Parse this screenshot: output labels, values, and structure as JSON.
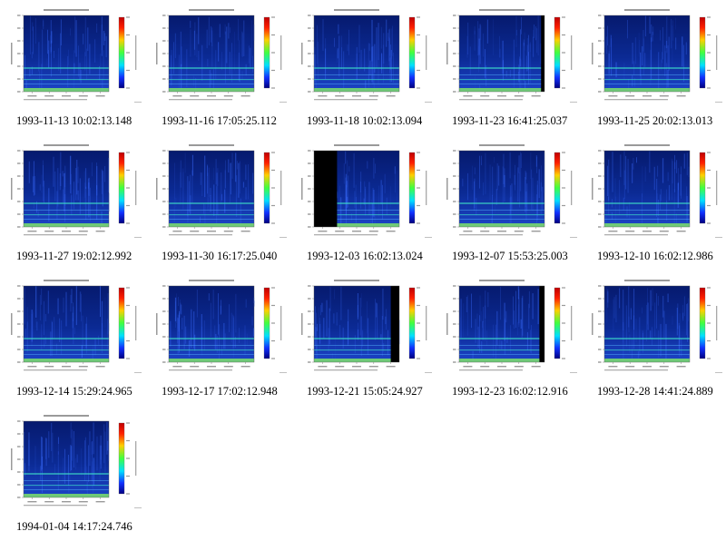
{
  "colors": {
    "background": "#ffffff",
    "caption_text": "#000000",
    "spectrogram_dark": "#061a6e",
    "spectrogram_mid": "#1c44c8",
    "band_line": "#3fe0c8",
    "baseline": "#7ee06a",
    "mask": "#000000"
  },
  "gallery": {
    "columns": 5,
    "items": [
      {
        "caption": "1993-11-13 10:02:13.148",
        "left_mask": 0,
        "right_mask": 0
      },
      {
        "caption": "1993-11-16 17:05:25.112",
        "left_mask": 0,
        "right_mask": 0
      },
      {
        "caption": "1993-11-18 10:02:13.094",
        "left_mask": 0,
        "right_mask": 0
      },
      {
        "caption": "1993-11-23 16:41:25.037",
        "left_mask": 0,
        "right_mask": 0.04
      },
      {
        "caption": "1993-11-25 20:02:13.013",
        "left_mask": 0,
        "right_mask": 0
      },
      {
        "caption": "1993-11-27 19:02:12.992",
        "left_mask": 0,
        "right_mask": 0
      },
      {
        "caption": "1993-11-30 16:17:25.040",
        "left_mask": 0,
        "right_mask": 0
      },
      {
        "caption": "1993-12-03 16:02:13.024",
        "left_mask": 0.27,
        "right_mask": 0
      },
      {
        "caption": "1993-12-07 15:53:25.003",
        "left_mask": 0,
        "right_mask": 0
      },
      {
        "caption": "1993-12-10 16:02:12.986",
        "left_mask": 0,
        "right_mask": 0
      },
      {
        "caption": "1993-12-14 15:29:24.965",
        "left_mask": 0,
        "right_mask": 0
      },
      {
        "caption": "1993-12-17 17:02:12.948",
        "left_mask": 0,
        "right_mask": 0
      },
      {
        "caption": "1993-12-21 15:05:24.927",
        "left_mask": 0,
        "right_mask": 0.1
      },
      {
        "caption": "1993-12-23 16:02:12.916",
        "left_mask": 0,
        "right_mask": 0.06
      },
      {
        "caption": "1993-12-28 14:41:24.889",
        "left_mask": 0,
        "right_mask": 0
      },
      {
        "caption": "1994-01-04 14:17:24.746",
        "left_mask": 0,
        "right_mask": 0
      }
    ]
  }
}
